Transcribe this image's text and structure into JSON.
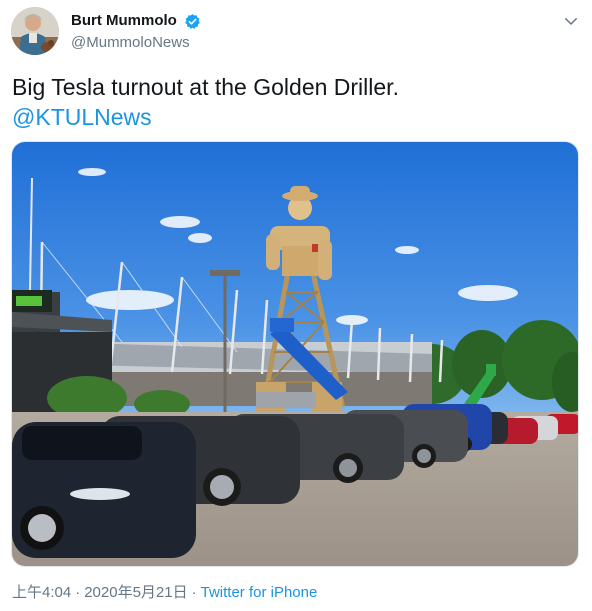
{
  "author": {
    "display_name": "Burt Mummolo",
    "handle": "@MummoloNews",
    "verified": true
  },
  "icons": {
    "verified": "verified-badge-icon",
    "more": "chevron-down-icon"
  },
  "tweet": {
    "text": "Big Tesla turnout at the Golden Driller.",
    "mention": "@KTULNews"
  },
  "meta": {
    "time": "上午4:04",
    "separator": "·",
    "date": "2020年5月21日",
    "source": "Twitter for iPhone"
  },
  "colors": {
    "link": "#1b95e0",
    "secondary_text": "#657786",
    "verified": "#1da1f2"
  }
}
